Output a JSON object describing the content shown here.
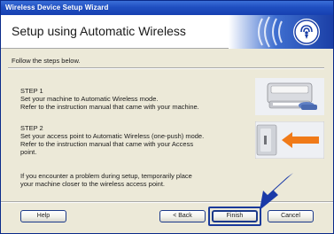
{
  "window": {
    "title": "Wireless Device Setup Wizard"
  },
  "banner": {
    "heading": "Setup using Automatic Wireless"
  },
  "content": {
    "intro": "Follow the steps below.",
    "step1": {
      "title": "STEP 1",
      "line1": "Set your machine to Automatic Wireless mode.",
      "line2": "Refer to the instruction manual that came with your machine."
    },
    "step2": {
      "title": "STEP 2",
      "line1": "Set your access point to Automatic Wireless (one-push) mode.",
      "line2": "Refer to the instruction manual that came with your Access",
      "line3": "point."
    },
    "note": {
      "line1": "If you encounter a problem during setup, temporarily place",
      "line2": "your machine closer to the wireless access point."
    }
  },
  "buttons": {
    "help": "Help",
    "back": "< Back",
    "finish": "Finish",
    "cancel": "Cancel"
  },
  "colors": {
    "titlebar": "#1f4fc1",
    "accent_arrow": "#1a3aa8",
    "orange_arrow": "#f07a18"
  },
  "icons": {
    "banner_art": "wireless-signal-icon",
    "step1_image": "printer-illustration",
    "step2_image": "access-point-button-illustration",
    "pointer": "pointer-arrow-icon"
  }
}
